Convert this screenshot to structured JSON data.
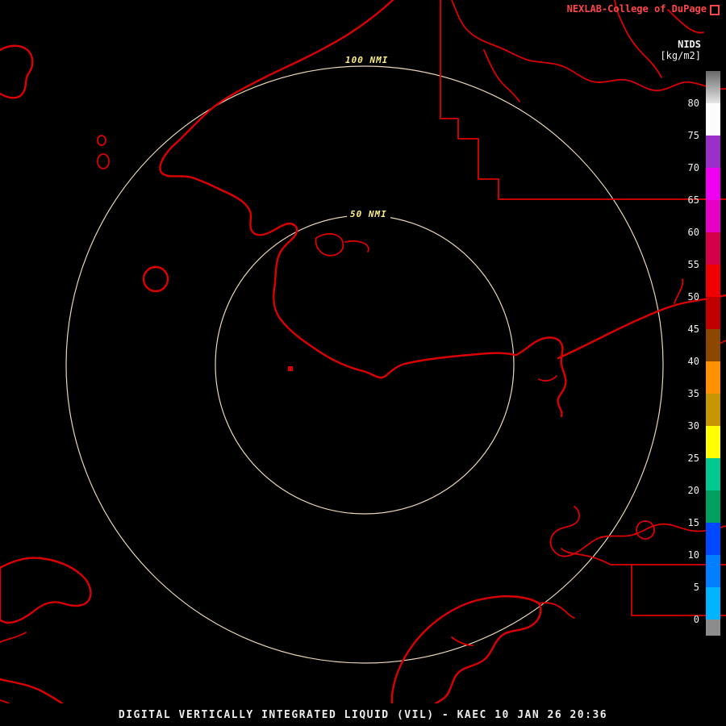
{
  "header": {
    "brand": "NEXLAB-College of DuPage"
  },
  "colorbar": {
    "title": "NIDS",
    "units": "[kg/m2]",
    "labels": [
      "80",
      "75",
      "70",
      "65",
      "60",
      "55",
      "50",
      "45",
      "40",
      "35",
      "30",
      "25",
      "20",
      "15",
      "10",
      "5",
      "0"
    ],
    "cap": {
      "range": ">80",
      "gradient_top": "#686868",
      "gradient_bottom": "#e6e6e6"
    },
    "segments": [
      {
        "range": "75-80",
        "color": "#fcfcfc"
      },
      {
        "range": "70-75",
        "color": "#9a30c8"
      },
      {
        "range": "65-70",
        "color": "#f000f0"
      },
      {
        "range": "60-65",
        "color": "#e400c4"
      },
      {
        "range": "55-60",
        "color": "#d4004a"
      },
      {
        "range": "50-55",
        "color": "#f00000"
      },
      {
        "range": "45-50",
        "color": "#c00000"
      },
      {
        "range": "40-45",
        "color": "#8c4800"
      },
      {
        "range": "35-40",
        "color": "#ff9000"
      },
      {
        "range": "30-35",
        "color": "#c89600"
      },
      {
        "range": "25-30",
        "color": "#ffff00"
      },
      {
        "range": "20-25",
        "color": "#00c890"
      },
      {
        "range": "15-20",
        "color": "#00a060"
      },
      {
        "range": "10-15",
        "color": "#0048ff"
      },
      {
        "range": "5-10",
        "color": "#0080ff"
      },
      {
        "range": "0-5",
        "color": "#00b4ff"
      }
    ],
    "below_zero": {
      "range": "<0",
      "color": "#8c8c8c"
    }
  },
  "rings": {
    "outer_label": "100 NMI",
    "inner_label": "50 NMI"
  },
  "map": {
    "line_color": "#dd0000",
    "ring_color": "#e9d6b5",
    "ring_label_color": "#ffee88",
    "background": "#000000"
  },
  "footer": {
    "caption": "DIGITAL VERTICALLY INTEGRATED LIQUID (VIL) - KAEC 10 JAN 26 20:36"
  }
}
